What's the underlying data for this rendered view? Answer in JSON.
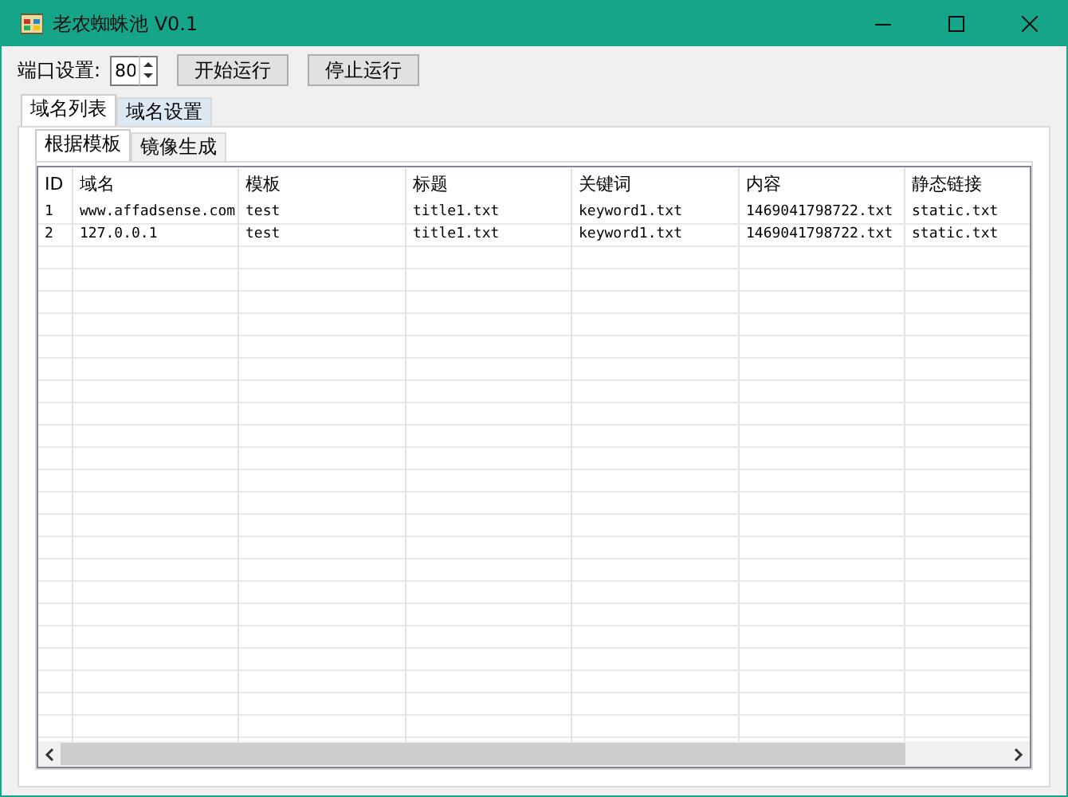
{
  "window": {
    "title": "老农蜘蛛池 V0.1"
  },
  "toolbar": {
    "port_label": "端口设置:",
    "port_value": "80",
    "buttons": [
      "开始运行",
      "停止运行"
    ]
  },
  "tabs": [
    {
      "label": "域名列表",
      "selected": true
    },
    {
      "label": "域名设置",
      "selected": false
    }
  ],
  "subtabs": [
    {
      "label": "根据模板",
      "selected": true
    },
    {
      "label": "镜像生成",
      "selected": false
    }
  ],
  "table": {
    "columns": [
      "ID",
      "域名",
      "模板",
      "标题",
      "关键词",
      "内容",
      "静态链接"
    ],
    "rows": [
      [
        "1",
        "www.affadsense.com",
        "test",
        "title1.txt",
        "keyword1.txt",
        "1469041798722.txt",
        "static.txt"
      ],
      [
        "2",
        "127.0.0.1",
        "test",
        "title1.txt",
        "keyword1.txt",
        "1469041798722.txt",
        "static.txt"
      ]
    ]
  }
}
